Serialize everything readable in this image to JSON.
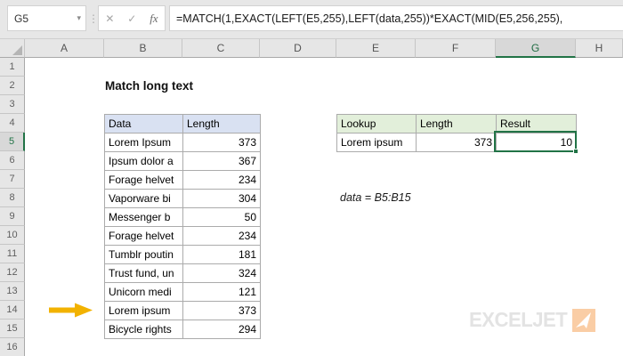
{
  "formula_bar": {
    "cell_reference": "G5",
    "dropdown_glyph": "▾",
    "dots_glyph": "⋮",
    "cancel_glyph": "✕",
    "confirm_glyph": "✓",
    "fx_label": "fx",
    "formula": "=MATCH(1,EXACT(LEFT(E5,255),LEFT(data,255))*EXACT(MID(E5,256,255),"
  },
  "grid": {
    "column_headers": [
      "A",
      "B",
      "C",
      "D",
      "E",
      "F",
      "G",
      "H"
    ],
    "row_headers": [
      "1",
      "2",
      "3",
      "4",
      "5",
      "6",
      "7",
      "8",
      "9",
      "10",
      "11",
      "12",
      "13",
      "14",
      "15",
      "16"
    ],
    "selected_column": "G",
    "selected_row": "5"
  },
  "sheet": {
    "title": "Match long text",
    "annotation": "data = B5:B15",
    "data_table": {
      "headers": [
        "Data",
        "Length"
      ],
      "rows": [
        [
          "Lorem Ipsum",
          "373"
        ],
        [
          "Ipsum dolor a",
          "367"
        ],
        [
          "Forage helvet",
          "234"
        ],
        [
          "Vaporware bi",
          "304"
        ],
        [
          "Messenger b",
          "50"
        ],
        [
          "Forage helvet",
          "234"
        ],
        [
          "Tumblr poutin",
          "181"
        ],
        [
          "Trust fund, un",
          "324"
        ],
        [
          "Unicorn medi",
          "121"
        ],
        [
          "Lorem ipsum",
          "373"
        ],
        [
          "Bicycle rights",
          "294"
        ]
      ]
    },
    "lookup_table": {
      "headers": [
        "Lookup",
        "Length",
        "Result"
      ],
      "rows": [
        [
          "Lorem ipsum",
          "373",
          "10"
        ]
      ]
    }
  },
  "branding": {
    "logo_text": "EXCELJET"
  },
  "colors": {
    "accent_green": "#217346",
    "data_header_fill": "#D9E1F2",
    "lookup_header_fill": "#E2EFDA",
    "arrow_yellow": "#F2B200",
    "logo_gray": "#E3E3E3",
    "logo_orange": "#FACDA5"
  }
}
